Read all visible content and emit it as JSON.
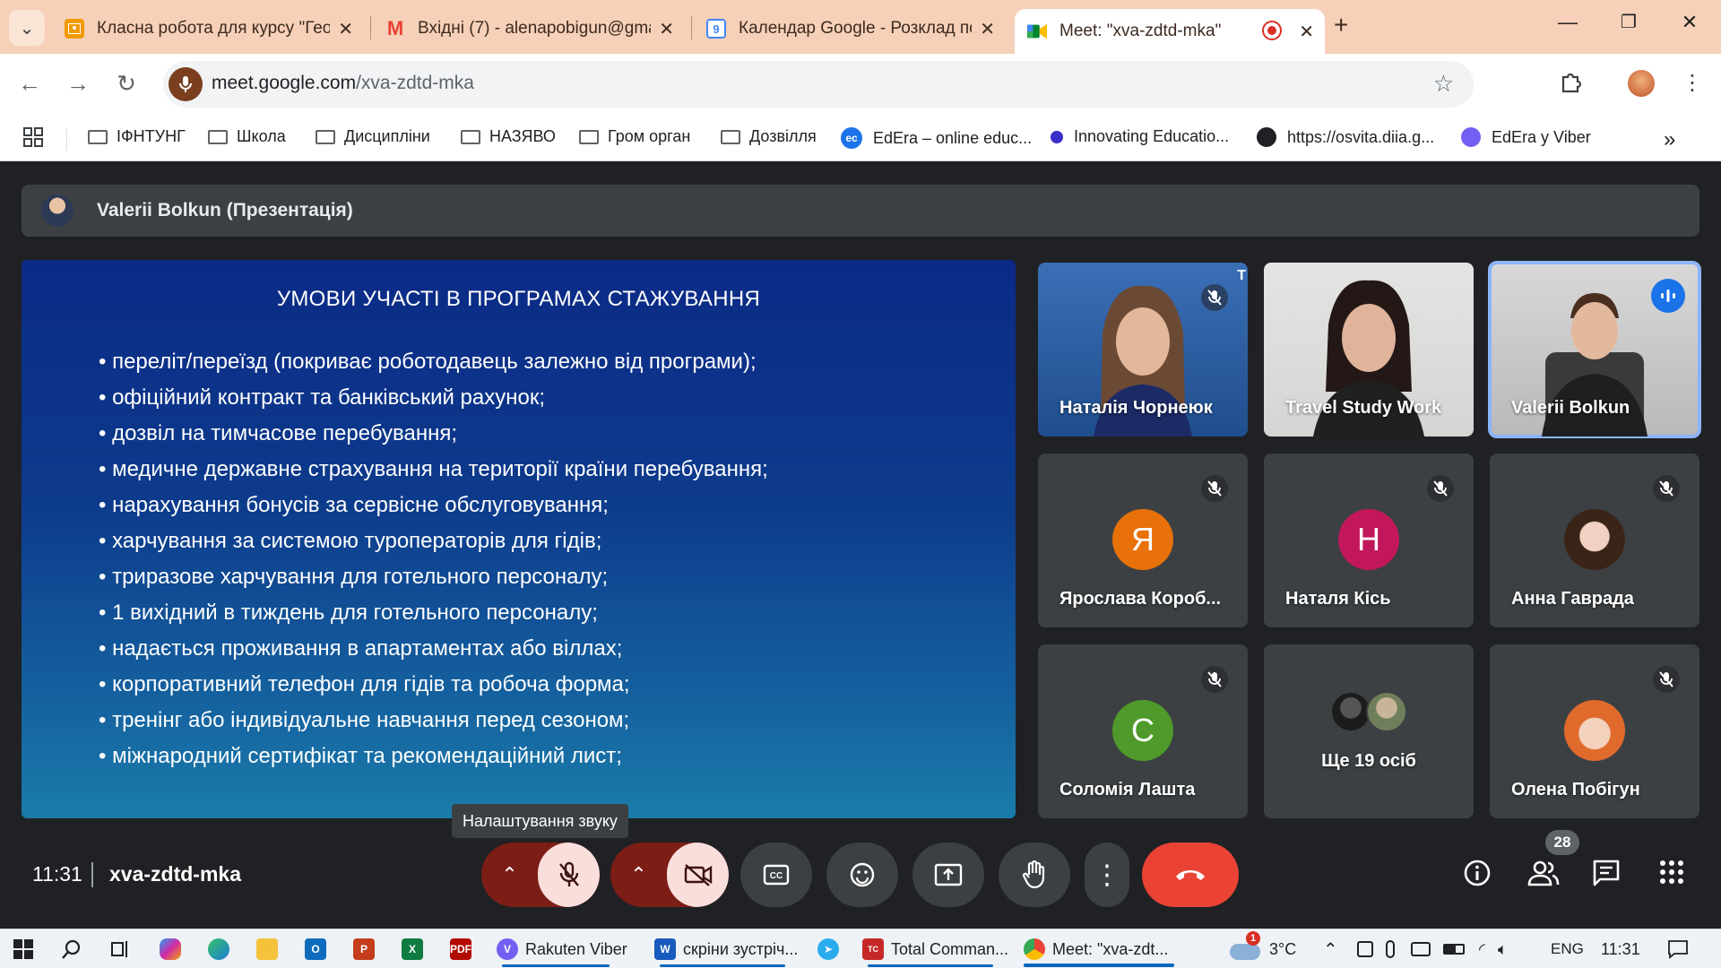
{
  "browser": {
    "tabs": [
      {
        "title": "Класна робота для курсу \"Гео",
        "icon_color": "#f29900",
        "icon": "classroom-icon"
      },
      {
        "title": "Вхідні (7) - alenapobigun@gma",
        "icon_color": "#ea4335",
        "icon": "gmail-icon",
        "icon_letter": "M"
      },
      {
        "title": "Календар Google - Розклад по",
        "icon_color": "#4285f4",
        "icon": "calendar-icon",
        "icon_letter": "9"
      },
      {
        "title": "Meet: \"xva-zdtd-mka\"",
        "icon_color": "#00832d",
        "icon": "meet-icon"
      }
    ],
    "url_host": "meet.google.com",
    "url_path": "/xva-zdtd-mka",
    "bookmarks": [
      {
        "label": "ІФНТУНГ",
        "type": "folder"
      },
      {
        "label": "Школа",
        "type": "folder"
      },
      {
        "label": "Дисципліни",
        "type": "folder"
      },
      {
        "label": "НАЗЯВО",
        "type": "folder"
      },
      {
        "label": "Гром орган",
        "type": "folder"
      },
      {
        "label": "Дозвілля",
        "type": "folder"
      },
      {
        "label": "EdEra – online educ...",
        "type": "site",
        "color": "#1a73e8"
      },
      {
        "label": "Innovating Educatio...",
        "type": "site",
        "color": "#3b2fc9"
      },
      {
        "label": "https://osvita.diia.g...",
        "type": "site",
        "color": "#202124"
      },
      {
        "label": "EdEra у Viber",
        "type": "site",
        "color": "#7360f2"
      }
    ]
  },
  "meet": {
    "presenter_label": "Valerii Bolkun (Презентація)",
    "slide": {
      "title": "УМОВИ УЧАСТІ В ПРОГРАМАХ СТАЖУВАННЯ",
      "items": [
        "переліт/переїзд (покриває роботодавець залежно від програми);",
        "офіційний контракт та банківський рахунок;",
        "дозвіл на тимчасове перебування;",
        "медичне державне страхування на території країни перебування;",
        "нарахування бонусів за сервісне обслуговування;",
        "харчування за системою туроператорів для гідів;",
        "триразове харчування для готельного персоналу;",
        "1 вихідний в тиждень для готельного персоналу;",
        "надається проживання в апартаментах або віллах;",
        "корпоративний телефон для гідів та робоча форма;",
        "тренінг або індивідуальне навчання перед сезоном;",
        "міжнародний сертифікат та рекомендаційний лист;"
      ]
    },
    "participants": [
      {
        "name": "Наталія Чорнеюк",
        "kind": "video",
        "muted": true
      },
      {
        "name": "Travel Study Work",
        "kind": "video",
        "muted": false
      },
      {
        "name": "Valerii Bolkun",
        "kind": "video",
        "speaking": true
      },
      {
        "name": "Ярослава Короб...",
        "kind": "letter",
        "letter": "Я",
        "color": "#e8710a",
        "muted": true
      },
      {
        "name": "Наталя Кісь",
        "kind": "letter",
        "letter": "Н",
        "color": "#c2185b",
        "muted": true
      },
      {
        "name": "Анна Гаврада",
        "kind": "photo",
        "muted": true
      },
      {
        "name": "Соломія Лашта",
        "kind": "letter",
        "letter": "С",
        "color": "#4f9a2a",
        "muted": true
      },
      {
        "name": "Ще 19 осіб",
        "kind": "more"
      },
      {
        "name": "Олена Побігун",
        "kind": "photo",
        "muted": true
      }
    ],
    "tooltip": "Налаштування звуку",
    "time": "11:31",
    "meeting_code": "xva-zdtd-mka",
    "people_count": "28",
    "colors": {
      "end_call": "#ea4335",
      "mic_off_bg": "#f9dedc",
      "active_speaker": "#8ab4f8"
    }
  },
  "taskbar": {
    "apps": [
      {
        "label": "Rakuten Viber",
        "color": "#7360f2",
        "glyph": "V"
      },
      {
        "label": "скріни зустріч...",
        "color": "#185abd",
        "glyph": "W"
      },
      {
        "label": "Total Comman...",
        "color": "#c62828",
        "glyph": "TC"
      },
      {
        "label": "Meet: \"xva-zdt...",
        "color": "#4285f4",
        "glyph": "◉"
      }
    ],
    "weather_badge": "1",
    "temperature": "3°C",
    "language": "ENG",
    "clock": "11:31"
  }
}
